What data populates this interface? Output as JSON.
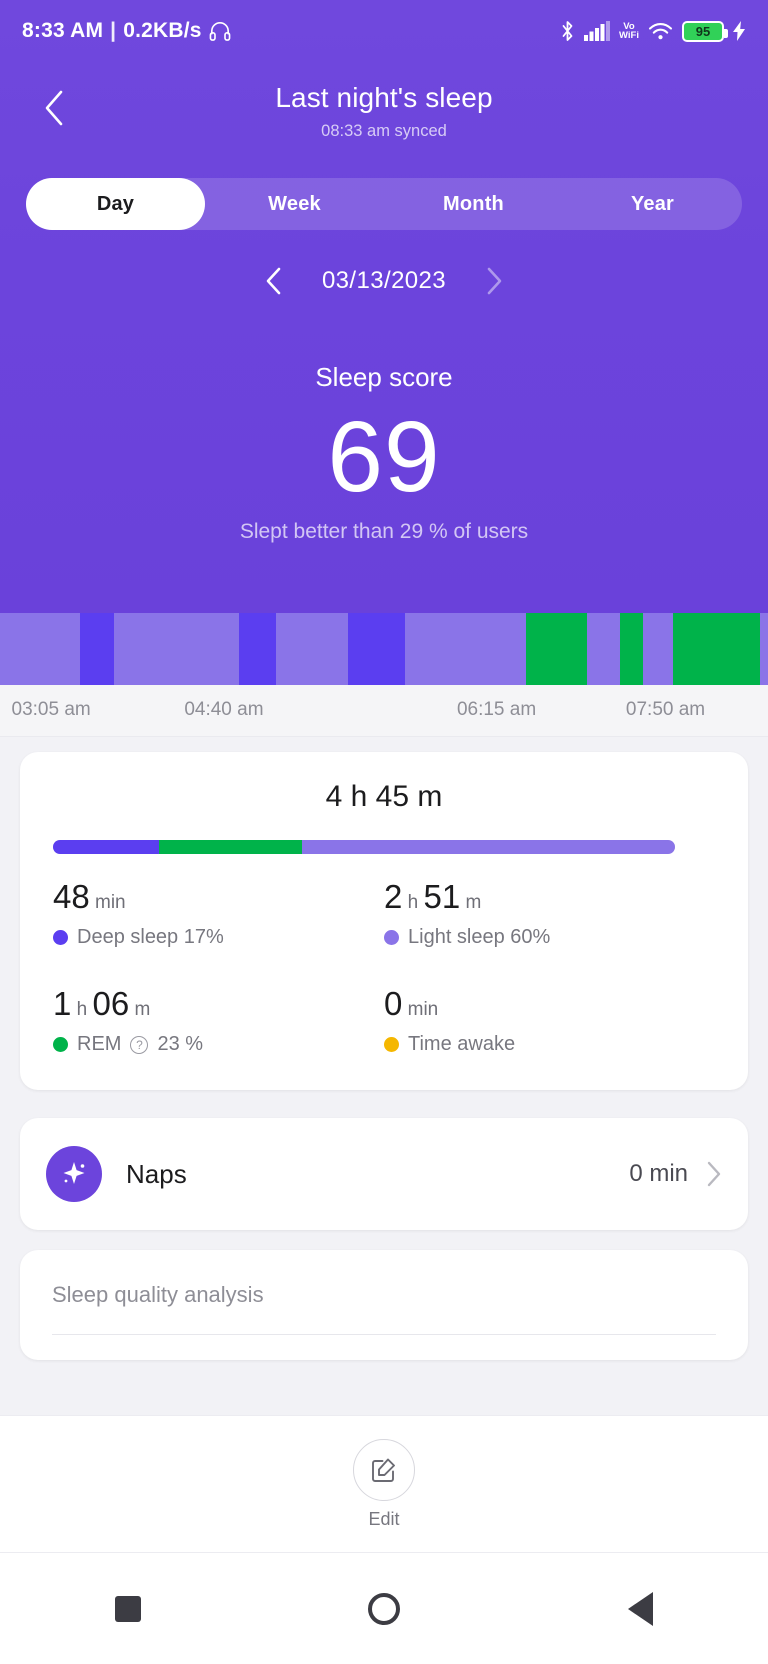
{
  "status_bar": {
    "time": "8:33 AM",
    "separator": "|",
    "network_speed": "0.2KB/s",
    "headphone_icon": "headphone-icon",
    "bluetooth_icon": "bluetooth-icon",
    "signal_icon": "cellular-signal-icon",
    "vowifi_line1": "Vo",
    "vowifi_line2": "WiFi",
    "wifi_icon": "wifi-icon",
    "battery_level": "95",
    "charging_icon": "charging-bolt-icon"
  },
  "header": {
    "back_icon": "back-chevron-icon",
    "title": "Last night's sleep",
    "subtitle": "08:33 am synced"
  },
  "tabs": {
    "items": [
      {
        "label": "Day",
        "active": true
      },
      {
        "label": "Week",
        "active": false
      },
      {
        "label": "Month",
        "active": false
      },
      {
        "label": "Year",
        "active": false
      }
    ]
  },
  "date_selector": {
    "prev_icon": "chevron-left-icon",
    "date": "03/13/2023",
    "next_icon": "chevron-right-icon"
  },
  "score": {
    "title": "Sleep score",
    "value": "69",
    "comparison": "Slept better than 29 % of users"
  },
  "colors": {
    "brand_purple": "#6c44dc",
    "deep_sleep": "#5b3ef0",
    "light_sleep": "#8a74e8",
    "rem": "#00b34a",
    "awake": "#f5b700",
    "hero_bg": "#6c44dc"
  },
  "hypnogram": {
    "segments": [
      {
        "stage": "light",
        "color": "#8a74e8",
        "width_pct": 10.4
      },
      {
        "stage": "deep",
        "color": "#5b3ef0",
        "width_pct": 4.4
      },
      {
        "stage": "light",
        "color": "#8a74e8",
        "width_pct": 16.3
      },
      {
        "stage": "deep",
        "color": "#5b3ef0",
        "width_pct": 4.8
      },
      {
        "stage": "light",
        "color": "#8a74e8",
        "width_pct": 9.4
      },
      {
        "stage": "deep",
        "color": "#5b3ef0",
        "width_pct": 7.5
      },
      {
        "stage": "light",
        "color": "#8a74e8",
        "width_pct": 15.7
      },
      {
        "stage": "rem",
        "color": "#00b34a",
        "width_pct": 8.0
      },
      {
        "stage": "light",
        "color": "#8a74e8",
        "width_pct": 4.2
      },
      {
        "stage": "rem",
        "color": "#00b34a",
        "width_pct": 3.0
      },
      {
        "stage": "light",
        "color": "#8a74e8",
        "width_pct": 3.9
      },
      {
        "stage": "rem",
        "color": "#00b34a",
        "width_pct": 11.4
      },
      {
        "stage": "light",
        "color": "#8a74e8",
        "width_pct": 1.0
      }
    ],
    "time_ticks": [
      {
        "label": "03:05 am",
        "left_pct": 1.5
      },
      {
        "label": "04:40 am",
        "left_pct": 24.0
      },
      {
        "label": "06:15 am",
        "left_pct": 59.5
      },
      {
        "label": "07:50 am",
        "left_pct": 81.5
      }
    ]
  },
  "sleep_card": {
    "total_duration": "4 h 45 m",
    "bar_segments": [
      {
        "name": "Deep sleep",
        "color": "#5b3ef0",
        "pct": 17
      },
      {
        "name": "REM",
        "color": "#00b34a",
        "pct": 23
      },
      {
        "name": "Light sleep",
        "color": "#8a74e8",
        "pct": 60
      }
    ],
    "stats": [
      {
        "value": "48",
        "unit": " min",
        "value2": "",
        "unit2": "",
        "label": "Deep sleep 17%",
        "dot_color": "#5b3ef0",
        "has_help": false
      },
      {
        "value": "2",
        "unit": " h ",
        "value2": "51",
        "unit2": " m",
        "label": "Light sleep 60%",
        "dot_color": "#8a74e8",
        "has_help": false
      },
      {
        "value": "1",
        "unit": " h ",
        "value2": "06",
        "unit2": " m",
        "label_pre": "REM",
        "label_post": "23 %",
        "label": "REM 23 %",
        "dot_color": "#00b34a",
        "has_help": true,
        "help_icon": "help-question-icon"
      },
      {
        "value": "0",
        "unit": " min",
        "value2": "",
        "unit2": "",
        "label": "Time awake",
        "dot_color": "#f5b700",
        "has_help": false
      }
    ]
  },
  "naps_card": {
    "icon": "sparkle-star-icon",
    "label": "Naps",
    "value": "0 min",
    "chevron_icon": "chevron-right-icon"
  },
  "quality_card": {
    "title": "Sleep quality analysis"
  },
  "toolbar": {
    "edit_icon": "edit-pencil-square-icon",
    "edit_label": "Edit"
  },
  "navbar": {
    "recents_icon": "square-recents-icon",
    "home_icon": "circle-home-icon",
    "back_icon": "triangle-back-icon"
  }
}
